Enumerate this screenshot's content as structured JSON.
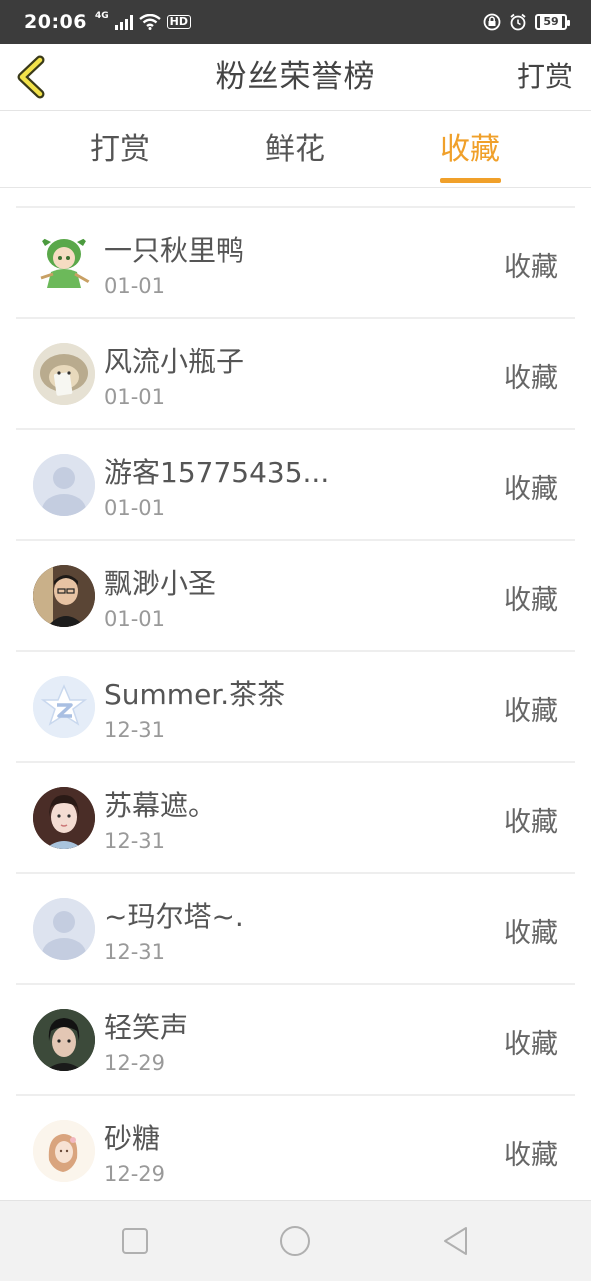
{
  "status_bar": {
    "time": "20:06",
    "network": "4G",
    "hd": "HD",
    "battery": "59"
  },
  "header": {
    "back_icon": "chevron-left-icon",
    "title": "粉丝荣誉榜",
    "right_action": "打赏"
  },
  "tabs": [
    {
      "label": "打赏",
      "active": false
    },
    {
      "label": "鲜花",
      "active": false
    },
    {
      "label": "收藏",
      "active": true
    }
  ],
  "colors": {
    "accent": "#f0a02a",
    "text": "#555555",
    "subtext": "#999999",
    "divider": "#eeeeee"
  },
  "list": [
    {
      "name": "一只秋里鸭",
      "date": "01-01",
      "action": "收藏",
      "avatar": "cartoon-avatar"
    },
    {
      "name": "风流小瓶子",
      "date": "01-01",
      "action": "收藏",
      "avatar": "hedgehog-avatar"
    },
    {
      "name": "游客15775435...",
      "date": "01-01",
      "action": "收藏",
      "avatar": "default-avatar"
    },
    {
      "name": "飘渺小圣",
      "date": "01-01",
      "action": "收藏",
      "avatar": "photo-avatar"
    },
    {
      "name": "Summer.茶茶",
      "date": "12-31",
      "action": "收藏",
      "avatar": "qzone-avatar"
    },
    {
      "name": "苏幕遮。",
      "date": "12-31",
      "action": "收藏",
      "avatar": "photo-avatar"
    },
    {
      "name": "~玛尔塔~.",
      "date": "12-31",
      "action": "收藏",
      "avatar": "default-avatar"
    },
    {
      "name": "轻笑声",
      "date": "12-29",
      "action": "收藏",
      "avatar": "photo-avatar"
    },
    {
      "name": "砂糖",
      "date": "12-29",
      "action": "收藏",
      "avatar": "illustration-avatar"
    }
  ],
  "nav_bar": {
    "icons": [
      "recent-apps-icon",
      "home-icon",
      "back-triangle-icon"
    ]
  }
}
